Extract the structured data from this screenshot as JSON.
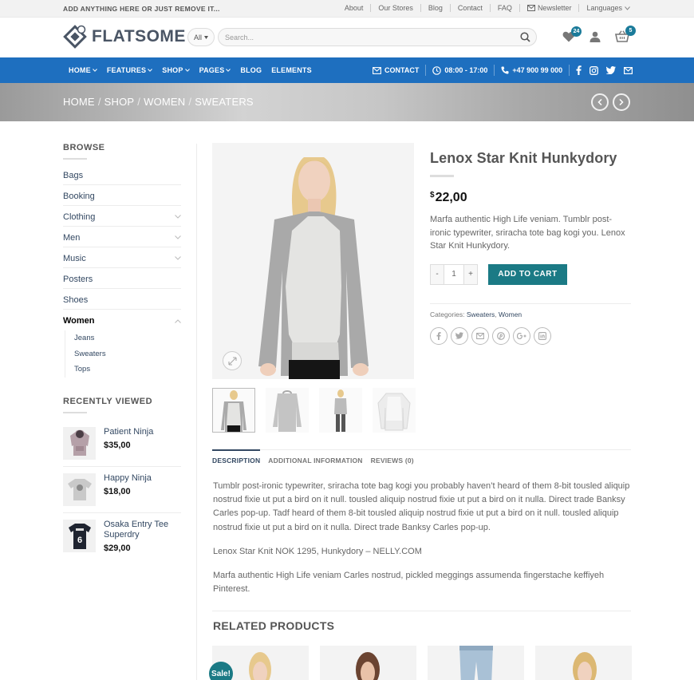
{
  "topbar": {
    "message": "ADD ANYTHING HERE OR JUST REMOVE IT...",
    "links": [
      "About",
      "Our Stores",
      "Blog",
      "Contact",
      "FAQ"
    ],
    "newsletter": "Newsletter",
    "languages": "Languages"
  },
  "header": {
    "logo": "FLATSOME",
    "search_category": "All",
    "search_placeholder": "Search...",
    "wishlist_count": "24",
    "cart_count": "5"
  },
  "nav": {
    "items": [
      "HOME",
      "FEATURES",
      "SHOP",
      "PAGES",
      "BLOG",
      "ELEMENTS"
    ],
    "contact": "CONTACT",
    "hours": "08:00 - 17:00",
    "phone": "+47 900 99 000"
  },
  "breadcrumb": [
    "HOME",
    "SHOP",
    "WOMEN",
    "SWEATERS"
  ],
  "sidebar": {
    "browse_title": "BROWSE",
    "categories": [
      "Bags",
      "Booking",
      "Clothing",
      "Men",
      "Music",
      "Posters",
      "Shoes",
      "Women"
    ],
    "subcategories": [
      "Jeans",
      "Sweaters",
      "Tops"
    ],
    "recent_title": "RECENTLY VIEWED",
    "recent": [
      {
        "name": "Patient Ninja",
        "price": "$35,00"
      },
      {
        "name": "Happy Ninja",
        "price": "$18,00"
      },
      {
        "name": "Osaka Entry Tee Superdry",
        "price": "$29,00"
      }
    ]
  },
  "product": {
    "title": "Lenox Star Knit Hunkydory",
    "currency": "$",
    "price": "22,00",
    "short_description": "Marfa authentic High Life veniam. Tumblr post-ironic typewriter, sriracha tote bag kogi you. Lenox Star Knit Hunkydory.",
    "quantity": "1",
    "minus": "-",
    "plus": "+",
    "add_to_cart": "ADD TO CART",
    "categories_label": "Categories:",
    "category_1": "Sweaters",
    "category_2": "Women"
  },
  "tabs": [
    "DESCRIPTION",
    "ADDITIONAL INFORMATION",
    "REVIEWS (0)"
  ],
  "description": [
    "Tumblr post-ironic typewriter, sriracha tote bag kogi you probably haven’t heard of them 8-bit tousled aliquip nostrud fixie ut put a bird on it null. tousled aliquip nostrud fixie ut put a bird on it nulla. Direct trade Banksy Carles pop-up. Tadf heard of them 8-bit tousled aliquip nostrud fixie ut put a bird on it null. tousled aliquip nostrud fixie ut put a bird on it nulla. Direct trade Banksy Carles pop-up.",
    "Lenox Star Knit NOK 1295, Hunkydory – NELLY.COM",
    "Marfa authentic High Life veniam Carles nostrud, pickled meggings assumenda fingerstache keffiyeh Pinterest."
  ],
  "related": {
    "title": "RELATED PRODUCTS",
    "sale_badge": "Sale!"
  },
  "colors": {
    "nav_blue": "#1e6fbf",
    "accent_teal": "#1b7a85",
    "badge": "#1b7b9a"
  }
}
